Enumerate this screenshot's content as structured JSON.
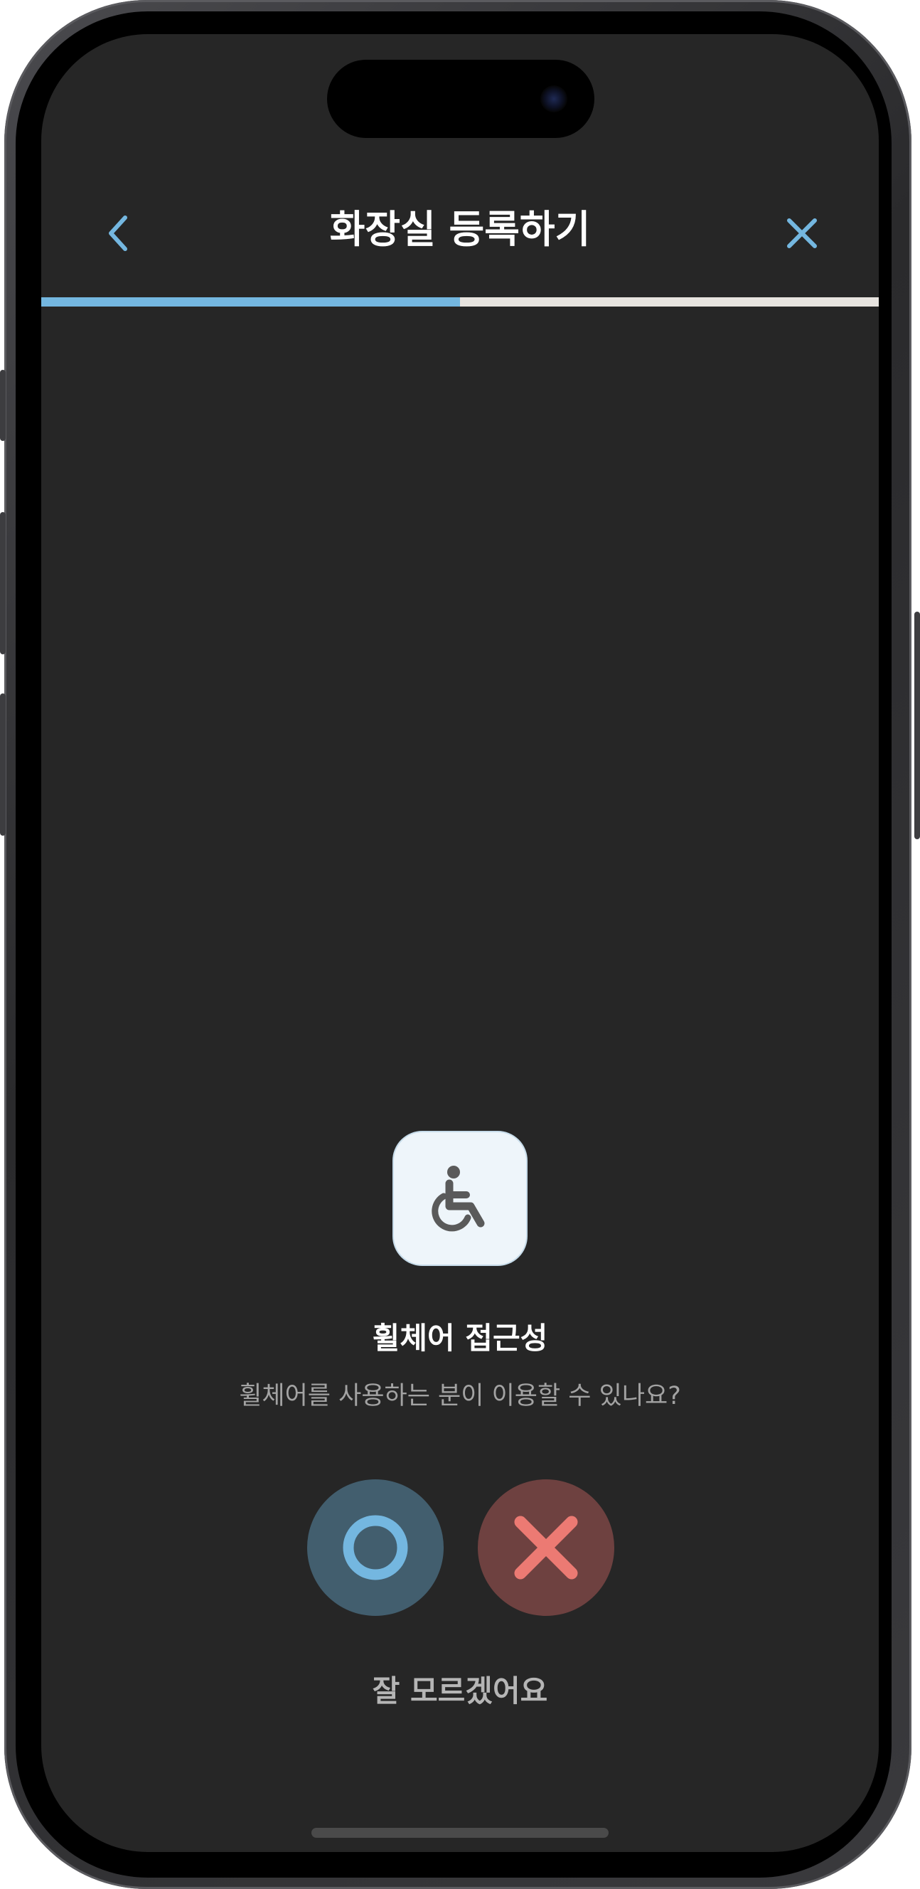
{
  "header": {
    "title": "화장실 등록하기",
    "back_icon": "chevron-left-icon",
    "close_icon": "close-icon",
    "accent_color": "#74b7e0"
  },
  "progress": {
    "value": 0.5,
    "fill_color": "#74b7e0",
    "track_color": "#e7e4df"
  },
  "question": {
    "icon": "wheelchair-icon",
    "title": "휠체어 접근성",
    "description": "휠체어를 사용하는 분이 이용할 수 있나요?"
  },
  "answers": {
    "yes_icon": "circle-o-icon",
    "yes_color": "#74b7e0",
    "no_icon": "x-mark-icon",
    "no_color": "#ec7a73",
    "unsure_label": "잘 모르겠어요"
  }
}
